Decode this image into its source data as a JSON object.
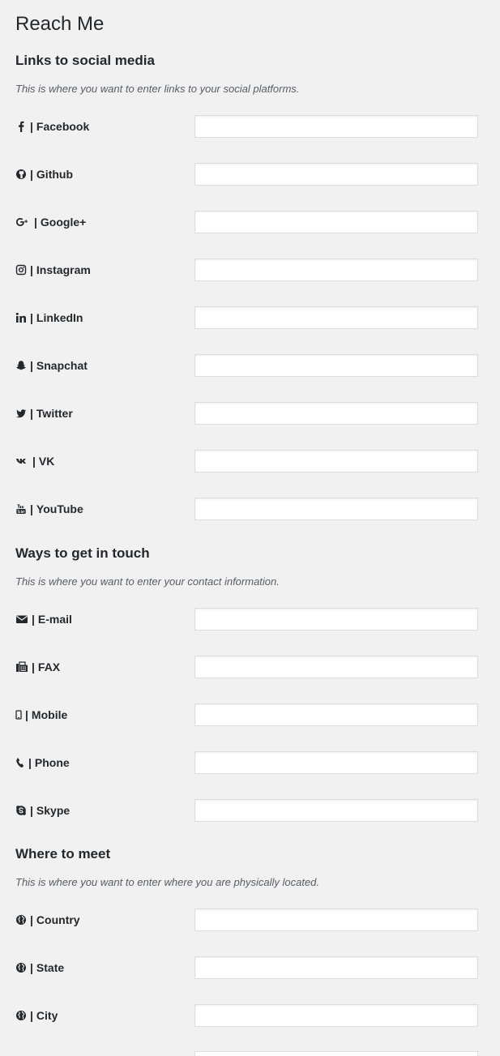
{
  "page": {
    "title": "Reach Me"
  },
  "sections": [
    {
      "title": "Links to social media",
      "description": "This is where you want to enter links to your social platforms.",
      "fields": [
        {
          "icon": "facebook-icon",
          "label": "Facebook",
          "value": ""
        },
        {
          "icon": "github-icon",
          "label": "Github",
          "value": ""
        },
        {
          "icon": "google-plus-icon",
          "label": "Google+",
          "value": ""
        },
        {
          "icon": "instagram-icon",
          "label": "Instagram",
          "value": ""
        },
        {
          "icon": "linkedin-icon",
          "label": "LinkedIn",
          "value": ""
        },
        {
          "icon": "snapchat-icon",
          "label": "Snapchat",
          "value": ""
        },
        {
          "icon": "twitter-icon",
          "label": "Twitter",
          "value": ""
        },
        {
          "icon": "vk-icon",
          "label": "VK",
          "value": ""
        },
        {
          "icon": "youtube-icon",
          "label": "YouTube",
          "value": ""
        }
      ]
    },
    {
      "title": "Ways to get in touch",
      "description": "This is where you want to enter your contact information.",
      "fields": [
        {
          "icon": "envelope-icon",
          "label": "E-mail",
          "value": ""
        },
        {
          "icon": "fax-icon",
          "label": "FAX",
          "value": ""
        },
        {
          "icon": "mobile-icon",
          "label": "Mobile",
          "value": ""
        },
        {
          "icon": "phone-icon",
          "label": "Phone",
          "value": ""
        },
        {
          "icon": "skype-icon",
          "label": "Skype",
          "value": ""
        }
      ]
    },
    {
      "title": "Where to meet",
      "description": "This is where you want to enter where you are physically located.",
      "fields": [
        {
          "icon": "globe-icon",
          "label": "Country",
          "value": ""
        },
        {
          "icon": "globe-icon",
          "label": "State",
          "value": ""
        },
        {
          "icon": "globe-icon",
          "label": "City",
          "value": ""
        }
      ]
    }
  ],
  "separator": "|",
  "colors": {
    "background": "#f1f1f1",
    "text": "#23282d",
    "description": "#555d66",
    "input_border": "#dddddd",
    "input_background": "#ffffff"
  }
}
